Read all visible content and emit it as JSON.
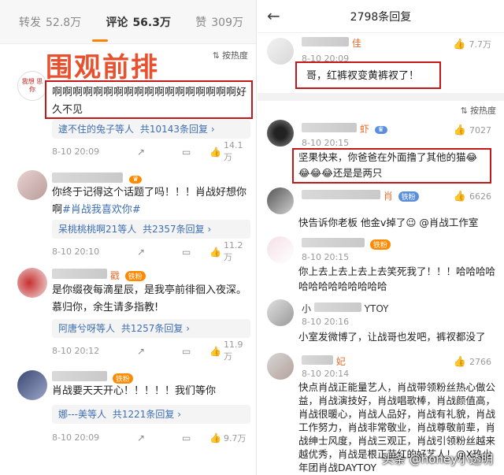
{
  "left": {
    "tabs": [
      {
        "label": "转发",
        "count": "52.8万"
      },
      {
        "label": "评论",
        "count": "56.3万"
      },
      {
        "label": "赞",
        "count": "309万"
      }
    ],
    "overlay_title": "围观前排",
    "sort_label": "按热度",
    "comments": [
      {
        "avatar_text": "我想 思你",
        "text": "啊啊啊啊啊啊啊啊啊啊啊啊啊啊啊啊啊啊好久不见",
        "reply_preview": "逮不住的兔子等人",
        "reply_count": "共10143条回复",
        "date": "8-10 20:09",
        "likes": "14.1万"
      },
      {
        "username": "",
        "text_main": "你终于记得这个话题了吗！！！肖战好想你啊",
        "tag": "#肖战我喜欢你#",
        "reply_preview": "呆桃桃桃啊21等人",
        "reply_count": "共2357条回复",
        "date": "8-10 20:10",
        "likes": "11.2万"
      },
      {
        "username": "戳",
        "badge": "铁粉",
        "text": "是你缀夜每滴星辰，是我亭前徘徊入夜深。慕归你，余生请多指教!",
        "reply_preview": "阿唐兮呀等人",
        "reply_count": "共1257条回复",
        "date": "8-10 20:12",
        "likes": "11.9万"
      },
      {
        "username": "",
        "badge": "铁粉",
        "text": "肖战要天天开心！！！！！我们等你",
        "reply_preview": "娜---美等人",
        "reply_count": "共1221条回复",
        "date": "8-10 20:09",
        "likes": "9.7万"
      }
    ]
  },
  "right": {
    "title": "2798条回复",
    "sort_label": "按热度",
    "top_comment": {
      "username": "佳",
      "date": "8-10 20:09",
      "likes": "7.7万",
      "text": "哥，红裤衩变黄裤衩了！"
    },
    "replies": [
      {
        "username": "虾",
        "date": "8-10 20:15",
        "likes": "7027",
        "text": "坚果快来，你爸爸在外面撸了其他的猫😂😂😂😂还是是两只"
      },
      {
        "username": "肖",
        "badge": "铁粉",
        "date": "",
        "likes": "6626",
        "text": "快告诉你老板 他金v掉了😉 @肖战工作室"
      },
      {
        "username": "",
        "badge": "铁粉",
        "date": "8-10 20:15",
        "likes": "",
        "text": "你上去上去上去上去笑死我了！！！哈哈哈哈哈哈哈哈哈哈哈哈哈"
      },
      {
        "username": "小",
        "username_suffix": "YTOY",
        "date": "8-10 20:16",
        "likes": "",
        "text": "小室发微博了，让战哥也发吧，裤衩都没了"
      },
      {
        "username": "妃",
        "date": "8-10 20:14",
        "likes": "2766",
        "text": "快点肖战正能量艺人，肖战带领粉丝热心做公益，肖战演技好，肖战唱歌棒，肖战颜值高，肖战很暖心，肖战人品好，肖战有礼貌，肖战工作努力，肖战非常敬业，肖战尊敬前辈，肖战绅士风度，肖战三观正，肖战引领粉丝越来越优秀，肖战是根正苗红的好艺人！@X玖少年团肖战DAYTOY"
      }
    ]
  },
  "footer_watermark": "头条 @honey小透明",
  "colors": {
    "accent": "#ff8200",
    "highlight_box": "#c41818",
    "link": "#3e6fb3",
    "username": "#e76b2c"
  }
}
